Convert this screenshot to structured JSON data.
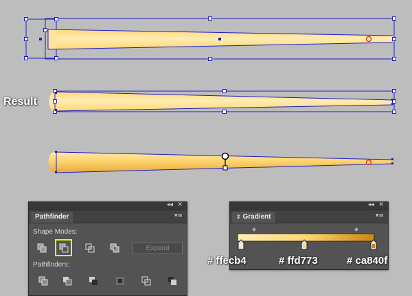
{
  "result_label": "Result",
  "colors": {
    "gradient_start": "#ffecb4",
    "gradient_mid": "#ffd773",
    "gradient_end": "#ca840f",
    "selection": "#1f1fbf",
    "canvas_bg": "#bdbdbd",
    "panel_bg": "#535353",
    "highlight": "#f2f200"
  },
  "pathfinder_panel": {
    "title": "Pathfinder",
    "shape_modes_label": "Shape Modes:",
    "shape_mode_icons": [
      "unite-icon",
      "minus-front-icon",
      "intersect-icon",
      "exclude-icon"
    ],
    "active_shape_mode": "minus-front-icon",
    "expand_label": "Expand",
    "pathfinders_label": "Pathfinders:",
    "pathfinder_icons": [
      "divide-icon",
      "trim-icon",
      "merge-icon",
      "crop-icon",
      "outline-icon",
      "minus-back-icon"
    ]
  },
  "gradient_panel": {
    "title": "Gradient",
    "stops": [
      "# ffecb4",
      "# ffd773",
      "# ca840f"
    ]
  }
}
